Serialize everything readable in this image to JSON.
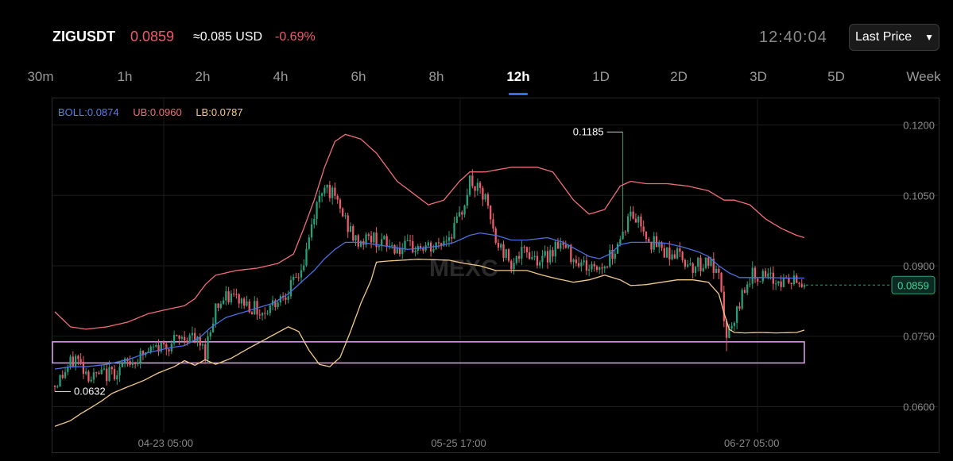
{
  "header": {
    "symbol": "ZIGUSDT",
    "price": "0.0859",
    "approx": "≈0.085 USD",
    "change": "-0.69%",
    "clock": "12:40:04",
    "price_type": "Last Price"
  },
  "tabs": [
    {
      "label": "30m"
    },
    {
      "label": "1h"
    },
    {
      "label": "2h"
    },
    {
      "label": "4h"
    },
    {
      "label": "6h"
    },
    {
      "label": "8h"
    },
    {
      "label": "12h",
      "active": true
    },
    {
      "label": "1D"
    },
    {
      "label": "2D"
    },
    {
      "label": "3D"
    },
    {
      "label": "5D"
    },
    {
      "label": "Week"
    }
  ],
  "legend": {
    "boll": "BOLL:0.0874",
    "ub": "UB:0.0960",
    "lb": "LB:0.0787"
  },
  "colors": {
    "up": "#26a17b",
    "down": "#ef5b6b",
    "boll": "#4a6fe0",
    "ub": "#ef6e7a",
    "lb": "#f3c98b",
    "zone": "#e3a6f0",
    "accent": "#2f6fe8"
  },
  "chart_data": {
    "type": "candlestick",
    "interval": "12h",
    "y_ticks": [
      "0.1200",
      "0.1050",
      "0.0900",
      "0.0750",
      "0.0600"
    ],
    "x_ticks": [
      "04-23 05:00",
      "05-25 17:00",
      "06-27 05:00"
    ],
    "ylim": [
      0.0545,
      0.1255
    ],
    "grid": true,
    "high_label": "0.1185",
    "low_label": "0.0632",
    "last_price_label": "0.0859",
    "zone": {
      "low": 0.0693,
      "high": 0.0738
    },
    "anchors": [
      [
        0,
        0.0645
      ],
      [
        8,
        0.0705
      ],
      [
        14,
        0.0662
      ],
      [
        22,
        0.0672
      ],
      [
        30,
        0.0698
      ],
      [
        38,
        0.0722
      ],
      [
        46,
        0.0738
      ],
      [
        52,
        0.0752
      ],
      [
        58,
        0.0718
      ],
      [
        62,
        0.0815
      ],
      [
        68,
        0.0835
      ],
      [
        74,
        0.082
      ],
      [
        80,
        0.08
      ],
      [
        86,
        0.083
      ],
      [
        92,
        0.086
      ],
      [
        96,
        0.0905
      ],
      [
        100,
        0.101
      ],
      [
        104,
        0.108
      ],
      [
        110,
        0.102
      ],
      [
        116,
        0.095
      ],
      [
        122,
        0.096
      ],
      [
        128,
        0.0945
      ],
      [
        134,
        0.0935
      ],
      [
        140,
        0.094
      ],
      [
        146,
        0.0935
      ],
      [
        152,
        0.0965
      ],
      [
        156,
        0.1
      ],
      [
        160,
        0.108
      ],
      [
        166,
        0.104
      ],
      [
        170,
        0.095
      ],
      [
        176,
        0.091
      ],
      [
        182,
        0.093
      ],
      [
        188,
        0.091
      ],
      [
        194,
        0.095
      ],
      [
        200,
        0.092
      ],
      [
        206,
        0.0895
      ],
      [
        212,
        0.09
      ],
      [
        218,
        0.096
      ],
      [
        222,
        0.101
      ],
      [
        226,
        0.099
      ],
      [
        230,
        0.095
      ],
      [
        236,
        0.093
      ],
      [
        240,
        0.0925
      ],
      [
        246,
        0.09
      ],
      [
        252,
        0.091
      ],
      [
        256,
        0.087
      ],
      [
        259,
        0.075
      ],
      [
        262,
        0.0775
      ],
      [
        266,
        0.086
      ],
      [
        270,
        0.0885
      ],
      [
        274,
        0.087
      ],
      [
        280,
        0.0868
      ],
      [
        286,
        0.0865
      ],
      [
        289,
        0.0859
      ]
    ],
    "upper_band": [
      [
        0,
        0.0802
      ],
      [
        6,
        0.077
      ],
      [
        12,
        0.0765
      ],
      [
        20,
        0.077
      ],
      [
        28,
        0.078
      ],
      [
        36,
        0.0798
      ],
      [
        44,
        0.0808
      ],
      [
        50,
        0.0815
      ],
      [
        54,
        0.083
      ],
      [
        58,
        0.086
      ],
      [
        62,
        0.088
      ],
      [
        70,
        0.089
      ],
      [
        78,
        0.0895
      ],
      [
        86,
        0.0905
      ],
      [
        92,
        0.0925
      ],
      [
        96,
        0.098
      ],
      [
        100,
        0.104
      ],
      [
        104,
        0.111
      ],
      [
        108,
        0.1165
      ],
      [
        112,
        0.118
      ],
      [
        118,
        0.117
      ],
      [
        124,
        0.114
      ],
      [
        132,
        0.108
      ],
      [
        138,
        0.1055
      ],
      [
        144,
        0.103
      ],
      [
        150,
        0.104
      ],
      [
        156,
        0.108
      ],
      [
        160,
        0.11
      ],
      [
        166,
        0.11
      ],
      [
        176,
        0.111
      ],
      [
        186,
        0.111
      ],
      [
        192,
        0.11
      ],
      [
        196,
        0.107
      ],
      [
        200,
        0.104
      ],
      [
        206,
        0.101
      ],
      [
        212,
        0.102
      ],
      [
        218,
        0.107
      ],
      [
        222,
        0.108
      ],
      [
        228,
        0.1075
      ],
      [
        236,
        0.1075
      ],
      [
        244,
        0.107
      ],
      [
        252,
        0.106
      ],
      [
        258,
        0.104
      ],
      [
        262,
        0.104
      ],
      [
        268,
        0.103
      ],
      [
        274,
        0.1
      ],
      [
        280,
        0.098
      ],
      [
        286,
        0.0965
      ],
      [
        289,
        0.096
      ]
    ],
    "mid_band": [
      [
        0,
        0.068
      ],
      [
        6,
        0.0685
      ],
      [
        12,
        0.0685
      ],
      [
        20,
        0.069
      ],
      [
        28,
        0.07
      ],
      [
        36,
        0.0715
      ],
      [
        44,
        0.0725
      ],
      [
        50,
        0.073
      ],
      [
        56,
        0.0748
      ],
      [
        60,
        0.0768
      ],
      [
        66,
        0.079
      ],
      [
        72,
        0.08
      ],
      [
        78,
        0.081
      ],
      [
        84,
        0.082
      ],
      [
        90,
        0.084
      ],
      [
        96,
        0.087
      ],
      [
        100,
        0.089
      ],
      [
        104,
        0.0915
      ],
      [
        108,
        0.0935
      ],
      [
        112,
        0.095
      ],
      [
        118,
        0.095
      ],
      [
        124,
        0.0945
      ],
      [
        130,
        0.094
      ],
      [
        136,
        0.0935
      ],
      [
        142,
        0.0938
      ],
      [
        148,
        0.0942
      ],
      [
        154,
        0.095
      ],
      [
        160,
        0.0965
      ],
      [
        164,
        0.097
      ],
      [
        170,
        0.0965
      ],
      [
        176,
        0.0955
      ],
      [
        182,
        0.0955
      ],
      [
        190,
        0.096
      ],
      [
        196,
        0.095
      ],
      [
        200,
        0.0938
      ],
      [
        206,
        0.092
      ],
      [
        210,
        0.0915
      ],
      [
        214,
        0.0925
      ],
      [
        218,
        0.0945
      ],
      [
        222,
        0.095
      ],
      [
        230,
        0.095
      ],
      [
        236,
        0.0948
      ],
      [
        242,
        0.094
      ],
      [
        248,
        0.093
      ],
      [
        252,
        0.092
      ],
      [
        256,
        0.09
      ],
      [
        260,
        0.0885
      ],
      [
        264,
        0.0875
      ],
      [
        270,
        0.0875
      ],
      [
        276,
        0.0875
      ],
      [
        282,
        0.0874
      ],
      [
        289,
        0.0874
      ]
    ],
    "lower_band": [
      [
        0,
        0.0558
      ],
      [
        6,
        0.057
      ],
      [
        10,
        0.0585
      ],
      [
        14,
        0.0598
      ],
      [
        18,
        0.0612
      ],
      [
        22,
        0.0628
      ],
      [
        28,
        0.0642
      ],
      [
        34,
        0.0655
      ],
      [
        40,
        0.0672
      ],
      [
        46,
        0.0685
      ],
      [
        50,
        0.0698
      ],
      [
        54,
        0.0688
      ],
      [
        58,
        0.07
      ],
      [
        62,
        0.069
      ],
      [
        68,
        0.0703
      ],
      [
        74,
        0.0722
      ],
      [
        80,
        0.074
      ],
      [
        86,
        0.0758
      ],
      [
        90,
        0.077
      ],
      [
        94,
        0.076
      ],
      [
        98,
        0.072
      ],
      [
        102,
        0.069
      ],
      [
        106,
        0.0685
      ],
      [
        110,
        0.0705
      ],
      [
        114,
        0.076
      ],
      [
        118,
        0.082
      ],
      [
        122,
        0.087
      ],
      [
        124,
        0.0908
      ],
      [
        128,
        0.091
      ],
      [
        134,
        0.0912
      ],
      [
        140,
        0.0914
      ],
      [
        146,
        0.0913
      ],
      [
        152,
        0.0912
      ],
      [
        158,
        0.0905
      ],
      [
        164,
        0.09
      ],
      [
        170,
        0.089
      ],
      [
        176,
        0.089
      ],
      [
        182,
        0.089
      ],
      [
        188,
        0.088
      ],
      [
        194,
        0.0872
      ],
      [
        200,
        0.0865
      ],
      [
        206,
        0.087
      ],
      [
        212,
        0.088
      ],
      [
        218,
        0.087
      ],
      [
        222,
        0.0858
      ],
      [
        228,
        0.086
      ],
      [
        234,
        0.0865
      ],
      [
        240,
        0.087
      ],
      [
        246,
        0.087
      ],
      [
        252,
        0.0865
      ],
      [
        256,
        0.084
      ],
      [
        258,
        0.08
      ],
      [
        260,
        0.0765
      ],
      [
        262,
        0.0758
      ],
      [
        266,
        0.0757
      ],
      [
        272,
        0.0758
      ],
      [
        278,
        0.0757
      ],
      [
        286,
        0.0758
      ],
      [
        289,
        0.0763
      ]
    ]
  }
}
